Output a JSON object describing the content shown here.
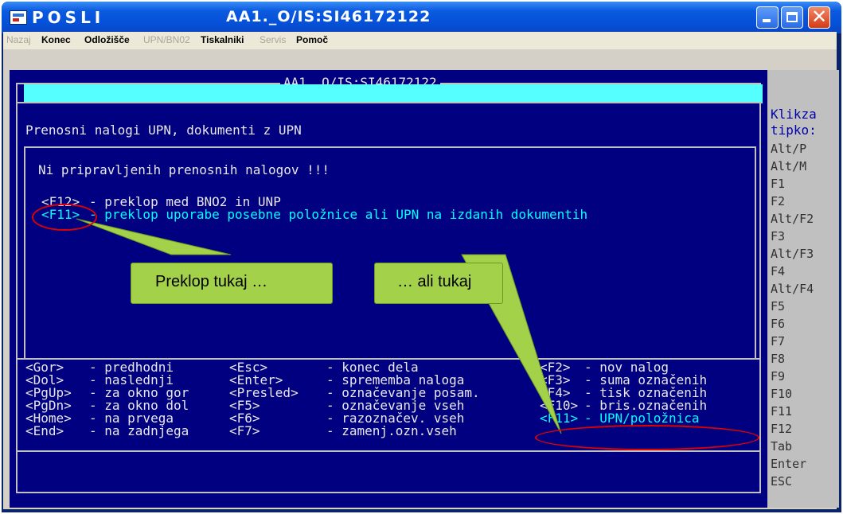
{
  "titlebar": {
    "app_name": "POSLI",
    "window_title": "AA1._O/IS:SI46172122"
  },
  "menu": [
    {
      "label": "Nazaj",
      "enabled": false
    },
    {
      "label": "Konec",
      "enabled": true
    },
    {
      "label": "Odložišče",
      "enabled": true
    },
    {
      "label": "UPN/BN02",
      "enabled": false
    },
    {
      "label": "Tiskalniki",
      "enabled": true
    },
    {
      "label": "Servis",
      "enabled": false
    },
    {
      "label": "Pomoč",
      "enabled": true
    }
  ],
  "screen": {
    "frame_title": "AA1._O/IS:SI46172122",
    "heading": "Prenosni nalogi UPN, dokumenti z UPN",
    "message": "Ni pripravljenih prenosnih nalogov !!!",
    "toggles": [
      {
        "key": "<F12>",
        "text": "- preklop med BNO2 in UNP"
      },
      {
        "key": "<F11>",
        "text": "- preklop uporabe posebne položnice ali UPN na izdanih dokumentih"
      }
    ],
    "help": {
      "col1": [
        {
          "key": "<Gor>",
          "desc": "- predhodni"
        },
        {
          "key": "<Dol>",
          "desc": "- naslednji"
        },
        {
          "key": "<PgUp>",
          "desc": "- za okno gor"
        },
        {
          "key": "<PgDn>",
          "desc": "- za okno dol"
        },
        {
          "key": "<Home>",
          "desc": "- na prvega"
        },
        {
          "key": "<End>",
          "desc": "- na zadnjega"
        }
      ],
      "col2": [
        {
          "key": "<Esc>",
          "desc": "- konec dela"
        },
        {
          "key": "<Enter>",
          "desc": "- sprememba naloga"
        },
        {
          "key": "<Presled>",
          "desc": "- označevanje posam."
        },
        {
          "key": "<F5>",
          "desc": "- označevanje vseh"
        },
        {
          "key": "<F6>",
          "desc": "- razoznačev. vseh"
        },
        {
          "key": "<F7>",
          "desc": "- zamenj.ozn.vseh"
        }
      ],
      "col3": [
        {
          "key": "<F2>",
          "desc": "- nov nalog"
        },
        {
          "key": "<F3>",
          "desc": "- suma označenih"
        },
        {
          "key": "<F4>",
          "desc": "- tisk označenih"
        },
        {
          "key": "<F10>",
          "desc": "- bris.označenih"
        },
        {
          "key": "<F11>",
          "desc": "- UPN/položnica"
        }
      ]
    }
  },
  "sidebar": {
    "title_line1": "Klikza",
    "title_line2": "tipko:",
    "keys": [
      "Alt/P",
      "Alt/M",
      "F1",
      "F2",
      "Alt/F2",
      "F3",
      "Alt/F3",
      "F4",
      "Alt/F4",
      "F5",
      "F6",
      "F7",
      "F8",
      "F9",
      "F10",
      "F11",
      "F12",
      "Tab",
      "Enter",
      "ESC"
    ]
  },
  "callouts": {
    "left": "Preklop tukaj …",
    "right": "… ali tukaj"
  },
  "colors": {
    "screen_bg": "#000080",
    "highlight_bar": "#55ffff",
    "callout_fill": "#a4d14a",
    "annotation_red": "#e00000"
  }
}
